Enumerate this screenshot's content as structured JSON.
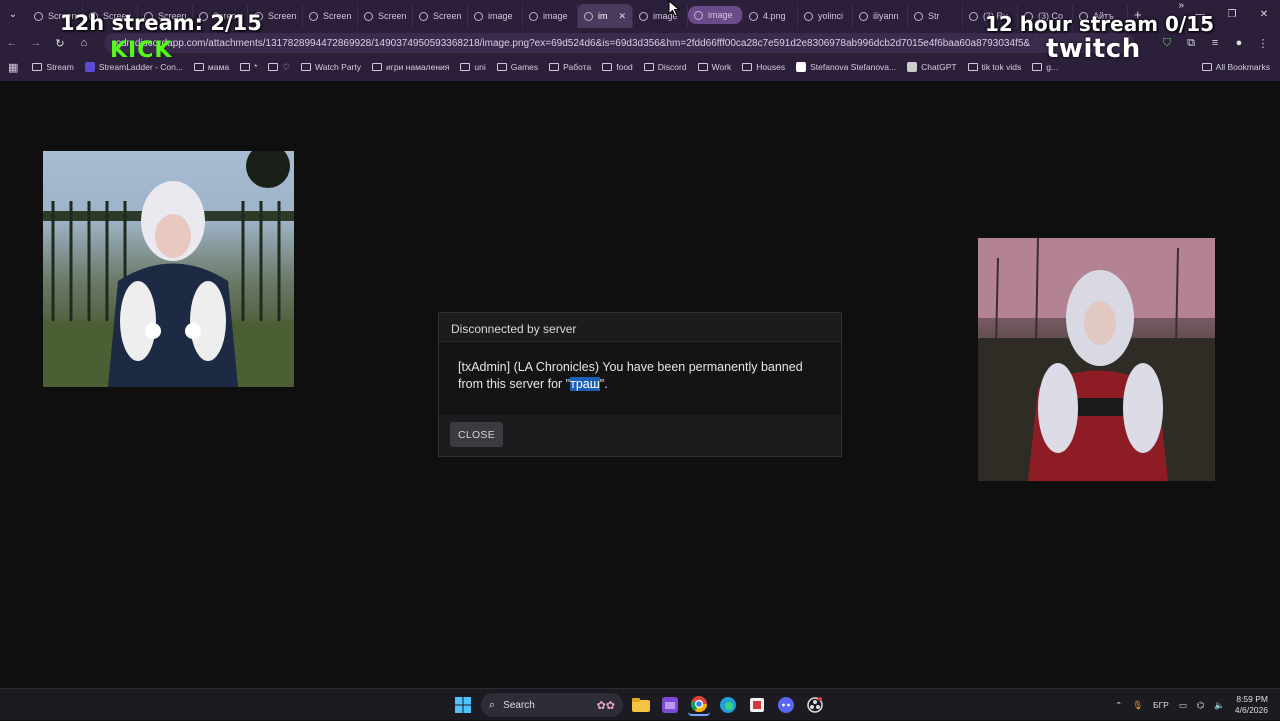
{
  "browser": {
    "tabs": [
      {
        "label": "Screen"
      },
      {
        "label": "Screen"
      },
      {
        "label": "Screen"
      },
      {
        "label": "Screen"
      },
      {
        "label": "Screen"
      },
      {
        "label": "Screen"
      },
      {
        "label": "Screen"
      },
      {
        "label": "Screen"
      },
      {
        "label": "image"
      },
      {
        "label": "image"
      },
      {
        "label": "im"
      },
      {
        "label": "image"
      },
      {
        "label": "image"
      },
      {
        "label": "4.png"
      },
      {
        "label": "yolinci"
      },
      {
        "label": "iliyann"
      },
      {
        "label": "Str"
      },
      {
        "label": "(3) Ru"
      },
      {
        "label": "(3) Co"
      },
      {
        "label": "Айтъ"
      }
    ],
    "url": "cdn.discordapp.com/attachments/1317828994472869928/1490374950593368218/image.png?ex=69d524d6&is=69d3d356&hm=2fdd66fff00ca28c7e591d2e8306978ab996dcb2d7015e4f6baa60a8793034f5&",
    "bookmarks": [
      {
        "label": "Stream",
        "type": "folder"
      },
      {
        "label": "StreamLadder - Con...",
        "type": "site",
        "color": "#5b4bd6"
      },
      {
        "label": "мама",
        "type": "folder"
      },
      {
        "label": "*",
        "type": "folder"
      },
      {
        "label": "♡",
        "type": "folder"
      },
      {
        "label": "Watch Party",
        "type": "folder"
      },
      {
        "label": "игри намаления",
        "type": "folder"
      },
      {
        "label": "uni",
        "type": "folder"
      },
      {
        "label": "Games",
        "type": "folder"
      },
      {
        "label": "Работа",
        "type": "folder"
      },
      {
        "label": "food",
        "type": "folder"
      },
      {
        "label": "Discord",
        "type": "folder"
      },
      {
        "label": "Work",
        "type": "folder"
      },
      {
        "label": "Houses",
        "type": "folder"
      },
      {
        "label": "Stefanova Stefanova...",
        "type": "site",
        "color": "#ffffff"
      },
      {
        "label": "ChatGPT",
        "type": "site",
        "color": "#cccccc"
      },
      {
        "label": "tik tok vids",
        "type": "folder"
      },
      {
        "label": "g...",
        "type": "folder"
      }
    ],
    "all_bookmarks": "All Bookmarks"
  },
  "overlay": {
    "left_counter": "12h stream: 2/15",
    "left_brand": "KICK",
    "right_counter": "12 hour stream 0/15",
    "right_brand": "twitch"
  },
  "dialog": {
    "title": "Disconnected by server",
    "message_before": "[txAdmin] (LA Chronicles) You have been permanently banned from this server for \"",
    "message_highlight": "траш",
    "message_after": "\".",
    "close_label": "CLOSE"
  },
  "taskbar": {
    "search_placeholder": "Search",
    "language": "БГР",
    "time": "8:59 PM",
    "date": "4/6/2026"
  }
}
